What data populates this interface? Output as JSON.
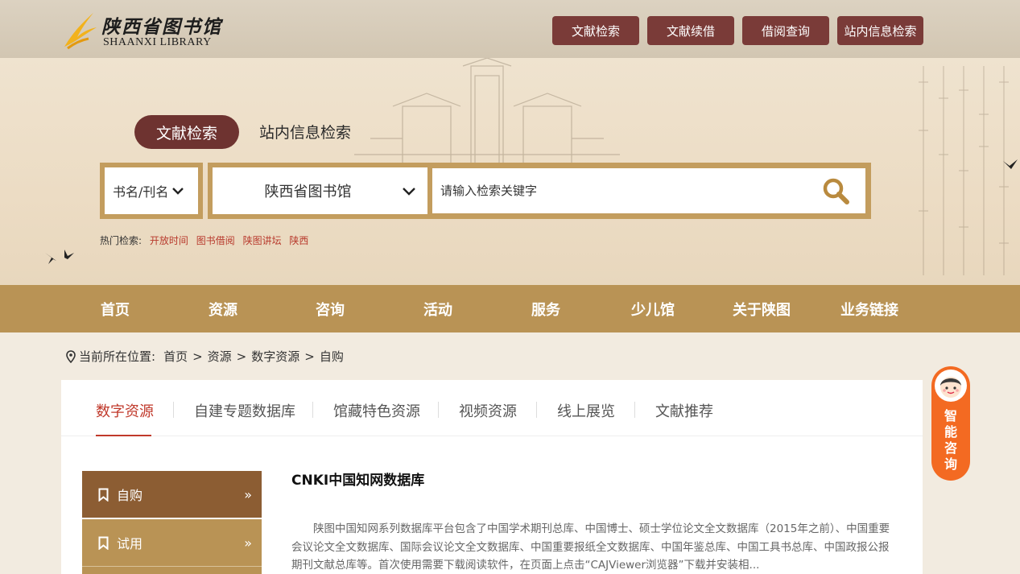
{
  "header": {
    "logo_cn": "陕西省图书馆",
    "logo_en": "SHAANXI LIBRARY",
    "buttons": [
      "文献检索",
      "文献续借",
      "借阅查询",
      "站内信息检索"
    ]
  },
  "search": {
    "tab_active": "文献检索",
    "tab_other": "站内信息检索",
    "field_select": "书名/刊名",
    "library_select": "陕西省图书馆",
    "placeholder": "请输入检索关键字",
    "hot_label": "热门检索:",
    "hot_links": [
      "开放时间",
      "图书借阅",
      "陕图讲坛",
      "陕西"
    ]
  },
  "nav": [
    "首页",
    "资源",
    "咨询",
    "活动",
    "服务",
    "少儿馆",
    "关于陕图",
    "业务链接"
  ],
  "breadcrumb": {
    "label": "当前所在位置:",
    "items": [
      "首页",
      "资源",
      "数字资源",
      "自购"
    ]
  },
  "tabs": [
    "数字资源",
    "自建专题数据库",
    "馆藏特色资源",
    "视频资源",
    "线上展览",
    "文献推荐"
  ],
  "sidebar": [
    "自购",
    "试用"
  ],
  "article": {
    "title": "CNKI中国知网数据库",
    "body": "陕图中国知网系列数据库平台包含了中国学术期刊总库、中国博士、硕士学位论文全文数据库（2015年之前）、中国重要会议论文全文数据库、国际会议论文全文数据库、中国重要报纸全文数据库、中国年鉴总库、中国工具书总库、中国政报公报期刊文献总库等。首次使用需要下载阅读软件，在页面上点击“CAJViewer浏览器”下载并安装相..."
  },
  "float": {
    "text": "智能咨询"
  },
  "colors": {
    "primary_dark": "#7a3b38",
    "nav_gold": "#b99355",
    "active_red": "#c0392b",
    "consult_orange": "#f36a22"
  }
}
